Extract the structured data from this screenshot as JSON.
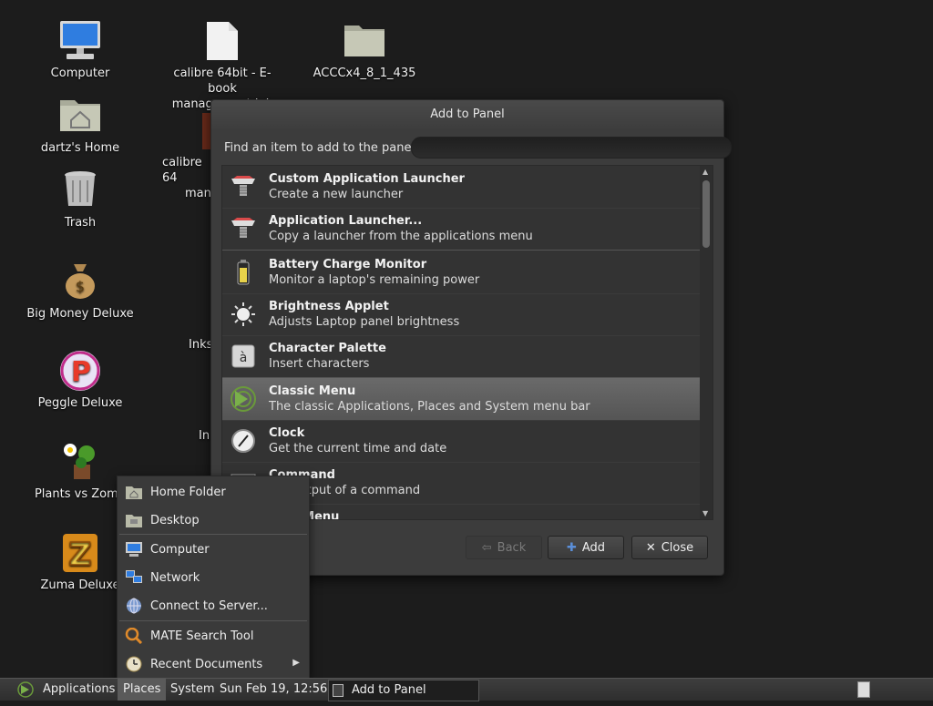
{
  "desktop": {
    "icons": [
      {
        "label": "Computer",
        "icon": "computer-icon"
      },
      {
        "label": "dartz's Home",
        "icon": "home-folder-icon"
      },
      {
        "label": "Trash",
        "icon": "trash-icon"
      },
      {
        "label": "Big Money Deluxe",
        "icon": "money-bag-icon"
      },
      {
        "label": "Peggle Deluxe",
        "icon": "peggle-icon"
      },
      {
        "label": "Plants vs Zomb",
        "icon": "plants-icon"
      },
      {
        "label": "Zuma Deluxe",
        "icon": "zuma-icon"
      },
      {
        "label": "calibre 64bit - E-book management.lnk",
        "icon": "file-icon"
      },
      {
        "label": "ACCCx4_8_1_435",
        "icon": "folder-icon"
      },
      {
        "label": "calibre 64",
        "icon": "calibre-icon"
      },
      {
        "label": "man",
        "icon": ""
      },
      {
        "label": "Inks",
        "icon": ""
      },
      {
        "label": "In",
        "icon": ""
      }
    ]
  },
  "dialog": {
    "title": "Add to Panel",
    "find_label": "Find an item to add to the panel:",
    "find_value": "",
    "items": [
      {
        "title": "Custom Application Launcher",
        "desc": "Create a new launcher",
        "icon": "launcher-icon"
      },
      {
        "title": "Application Launcher...",
        "desc": "Copy a launcher from the applications menu",
        "icon": "launcher-icon"
      },
      {
        "title": "Battery Charge Monitor",
        "desc": "Monitor a laptop's remaining power",
        "icon": "battery-icon"
      },
      {
        "title": "Brightness Applet",
        "desc": "Adjusts Laptop panel brightness",
        "icon": "brightness-icon"
      },
      {
        "title": "Character Palette",
        "desc": "Insert characters",
        "icon": "character-palette-icon"
      },
      {
        "title": "Classic Menu",
        "desc": "The classic Applications, Places and System menu bar",
        "icon": "classic-menu-icon"
      },
      {
        "title": "Clock",
        "desc": "Get the current time and date",
        "icon": "clock-icon"
      },
      {
        "title": "Command",
        "desc": "the output of a command",
        "icon": "command-icon"
      },
      {
        "title": "rt Menu",
        "desc": "",
        "icon": ""
      }
    ],
    "buttons": {
      "back": "Back",
      "add": "Add",
      "close": "Close"
    }
  },
  "places_menu": {
    "items": [
      {
        "label": "Home Folder",
        "icon": "home-folder-icon"
      },
      {
        "label": "Desktop",
        "icon": "desktop-folder-icon"
      },
      {
        "label": "Computer",
        "icon": "computer-icon"
      },
      {
        "label": "Network",
        "icon": "network-icon"
      },
      {
        "label": "Connect to Server...",
        "icon": "globe-icon"
      },
      {
        "label": "MATE Search Tool",
        "icon": "search-icon"
      },
      {
        "label": "Recent Documents",
        "icon": "recent-documents-icon"
      }
    ]
  },
  "panel": {
    "applications": "Applications",
    "places": "Places",
    "system": "System",
    "clock": "Sun Feb 19, 12:56",
    "task": "Add to Panel"
  }
}
